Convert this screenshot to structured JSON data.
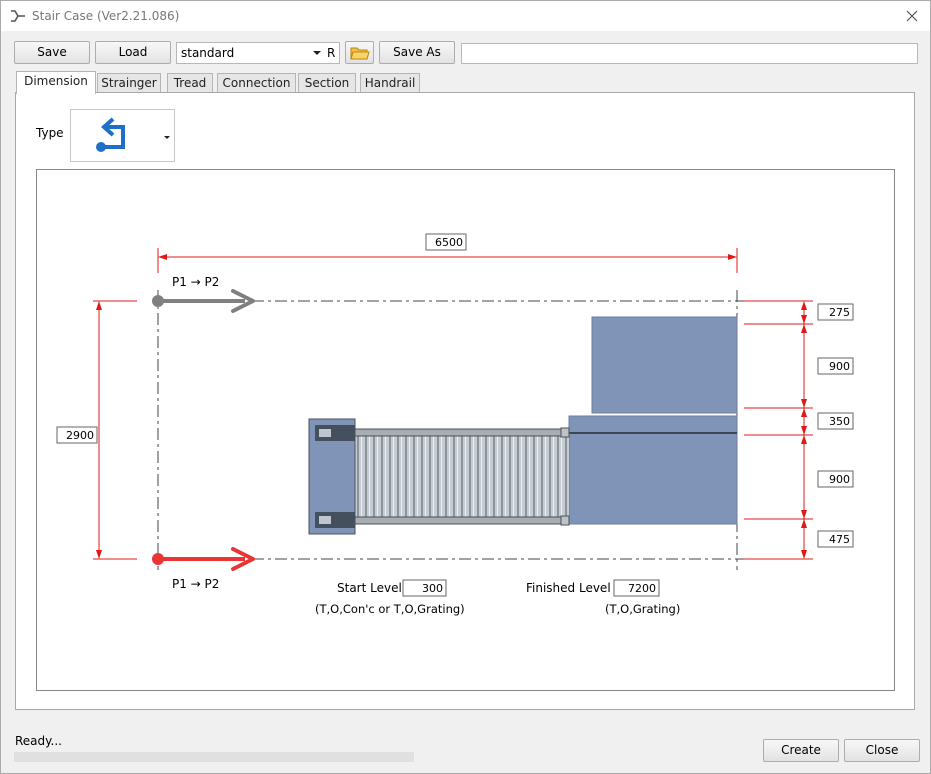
{
  "window": {
    "title": "Stair Case (Ver2.21.086)"
  },
  "toolbar": {
    "save_label": "Save",
    "load_label": "Load",
    "preset_value": "standard",
    "r_label": "R",
    "save_as_label": "Save As",
    "path_value": ""
  },
  "tabs": [
    {
      "label": "Dimension",
      "active": true
    },
    {
      "label": "Strainger",
      "active": false
    },
    {
      "label": "Tread",
      "active": false
    },
    {
      "label": "Connection",
      "active": false
    },
    {
      "label": "Section",
      "active": false
    },
    {
      "label": "Handrail",
      "active": false
    }
  ],
  "dimension": {
    "type_label": "Type",
    "type_icon": "stair-turn-icon",
    "width": "6500",
    "height": "2900",
    "segments": [
      "275",
      "900",
      "350",
      "900",
      "475"
    ],
    "p_top_label": "P1 → P2",
    "p_bottom_label": "P1 → P2",
    "start_level_label": "Start Level",
    "start_level_value": "300",
    "start_level_note": "(T,O,Con'c or T,O,Grating)",
    "finished_level_label": "Finished Level",
    "finished_level_value": "7200",
    "finished_level_note": "(T,O,Grating)"
  },
  "colors": {
    "dimension_line": "#e01818",
    "arrow_gray": "#808080",
    "arrow_red": "#ea3535",
    "platform": "#8094b8"
  },
  "status": {
    "text": "Ready..."
  },
  "footer": {
    "create_label": "Create",
    "close_label": "Close"
  }
}
